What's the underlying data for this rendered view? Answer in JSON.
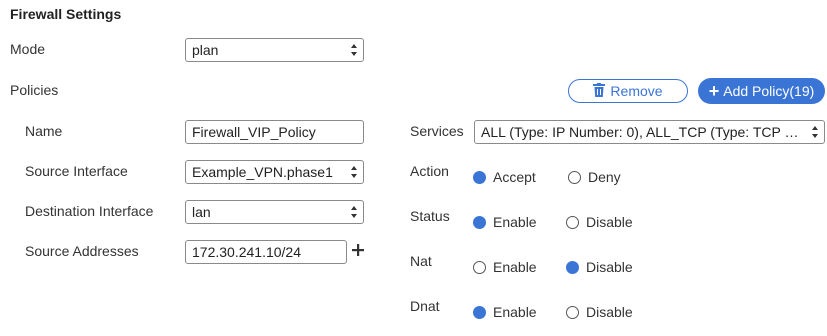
{
  "header": {
    "title": "Firewall Settings"
  },
  "mode": {
    "label": "Mode",
    "value": "plan"
  },
  "policies": {
    "label": "Policies",
    "remove_label": "Remove",
    "add_label": "Add Policy(19)"
  },
  "policy": {
    "name": {
      "label": "Name",
      "value": "Firewall_VIP_Policy"
    },
    "source_interface": {
      "label": "Source Interface",
      "value": "Example_VPN.phase1"
    },
    "destination_interface": {
      "label": "Destination Interface",
      "value": "lan"
    },
    "source_addresses": {
      "label": "Source Addresses",
      "value": "172.30.241.10/24"
    },
    "services": {
      "label": "Services",
      "value": "ALL (Type: IP Number: 0), ALL_TCP (Type: TCP Port..."
    },
    "action": {
      "label": "Action",
      "options": [
        "Accept",
        "Deny"
      ],
      "selected": "Accept"
    },
    "status": {
      "label": "Status",
      "options": [
        "Enable",
        "Disable"
      ],
      "selected": "Enable"
    },
    "nat": {
      "label": "Nat",
      "options": [
        "Enable",
        "Disable"
      ],
      "selected": "Disable"
    },
    "dnat": {
      "label": "Dnat",
      "options": [
        "Enable",
        "Disable"
      ],
      "selected": "Enable"
    }
  },
  "colors": {
    "accent": "#3a75d6"
  }
}
